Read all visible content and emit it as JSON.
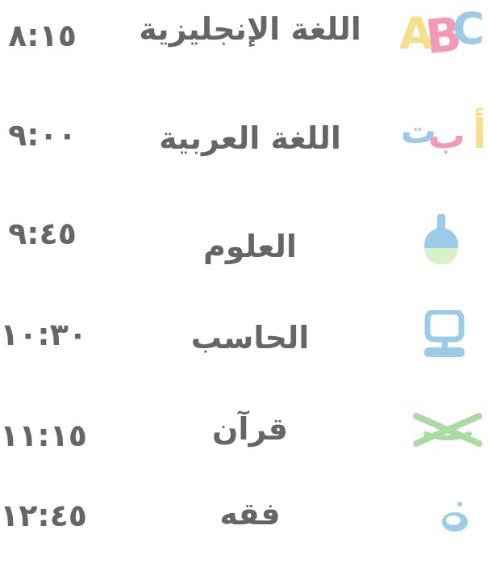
{
  "schedule": [
    {
      "time": "٨:١٥",
      "subject": "اللغة الإنجليزية",
      "icon": "abc-letters-icon",
      "icon_text": "ABC"
    },
    {
      "time": "٩:٠٠",
      "subject": "اللغة العربية",
      "icon": "arabic-letters-icon",
      "icon_text": "أبت"
    },
    {
      "time": "٩:٤٥",
      "subject": "العلوم",
      "icon": "flask-icon"
    },
    {
      "time": "١٠:٣٠",
      "subject": "الحاسب",
      "icon": "computer-icon"
    },
    {
      "time": "١١:١٥",
      "subject": "قرآن",
      "icon": "open-book-icon"
    },
    {
      "time": "١٢:٤٥",
      "subject": "فقه",
      "icon": "crescent-moon-icon"
    }
  ],
  "colors": {
    "text": "#666666",
    "pink": "#f29ab4",
    "yellow": "#f7e08a",
    "blue": "#9ccbea",
    "green": "#a9dba3",
    "light_green": "#d8f2c8"
  }
}
